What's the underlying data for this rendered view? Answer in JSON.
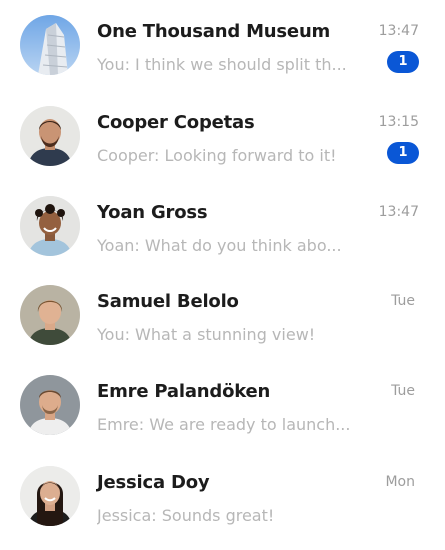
{
  "conversations": [
    {
      "name": "One Thousand Museum",
      "preview": "You: I think we should split th...",
      "time": "13:47",
      "unread": "1",
      "avatar_icon": "building-avatar-icon"
    },
    {
      "name": "Cooper Copetas",
      "preview": "Cooper: Looking forward to it!",
      "time": "13:15",
      "unread": "1",
      "avatar_icon": "person-avatar-icon"
    },
    {
      "name": "Yoan Gross",
      "preview": "Yoan: What do you think abo...",
      "time": "13:47",
      "avatar_icon": "person-avatar-icon"
    },
    {
      "name": "Samuel Belolo",
      "preview": "You: What a stunning view!",
      "time": "Tue",
      "avatar_icon": "person-avatar-icon"
    },
    {
      "name": "Emre Palandöken",
      "preview": "Emre: We are ready to launch...",
      "time": "Tue",
      "avatar_icon": "person-avatar-icon"
    },
    {
      "name": "Jessica Doy",
      "preview": "Jessica: Sounds great!",
      "time": "Mon",
      "avatar_icon": "person-avatar-icon"
    }
  ],
  "colors": {
    "badge": "#0a57d6",
    "name_text": "#1c1c1c",
    "preview_text": "#b7b7b7",
    "time_text": "#9d9d9d"
  }
}
